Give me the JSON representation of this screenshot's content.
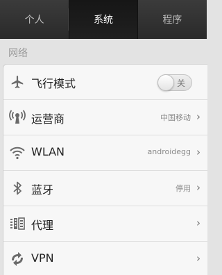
{
  "tabs": [
    {
      "label": "个人",
      "active": false
    },
    {
      "label": "系统",
      "active": true
    },
    {
      "label": "程序",
      "active": false
    }
  ],
  "section": {
    "title": "网络"
  },
  "rows": [
    {
      "icon": "airplane-icon",
      "label": "飞行模式",
      "toggle": {
        "text": "关",
        "state": "off"
      }
    },
    {
      "icon": "carrier-icon",
      "label": "运营商",
      "value": "中国移动"
    },
    {
      "icon": "wifi-icon",
      "label": "WLAN",
      "value": "androidegg"
    },
    {
      "icon": "bluetooth-icon",
      "label": "蓝牙",
      "value": "停用"
    },
    {
      "icon": "proxy-icon",
      "label": "代理",
      "value": ""
    },
    {
      "icon": "vpn-icon",
      "label": "VPN",
      "value": ""
    }
  ]
}
